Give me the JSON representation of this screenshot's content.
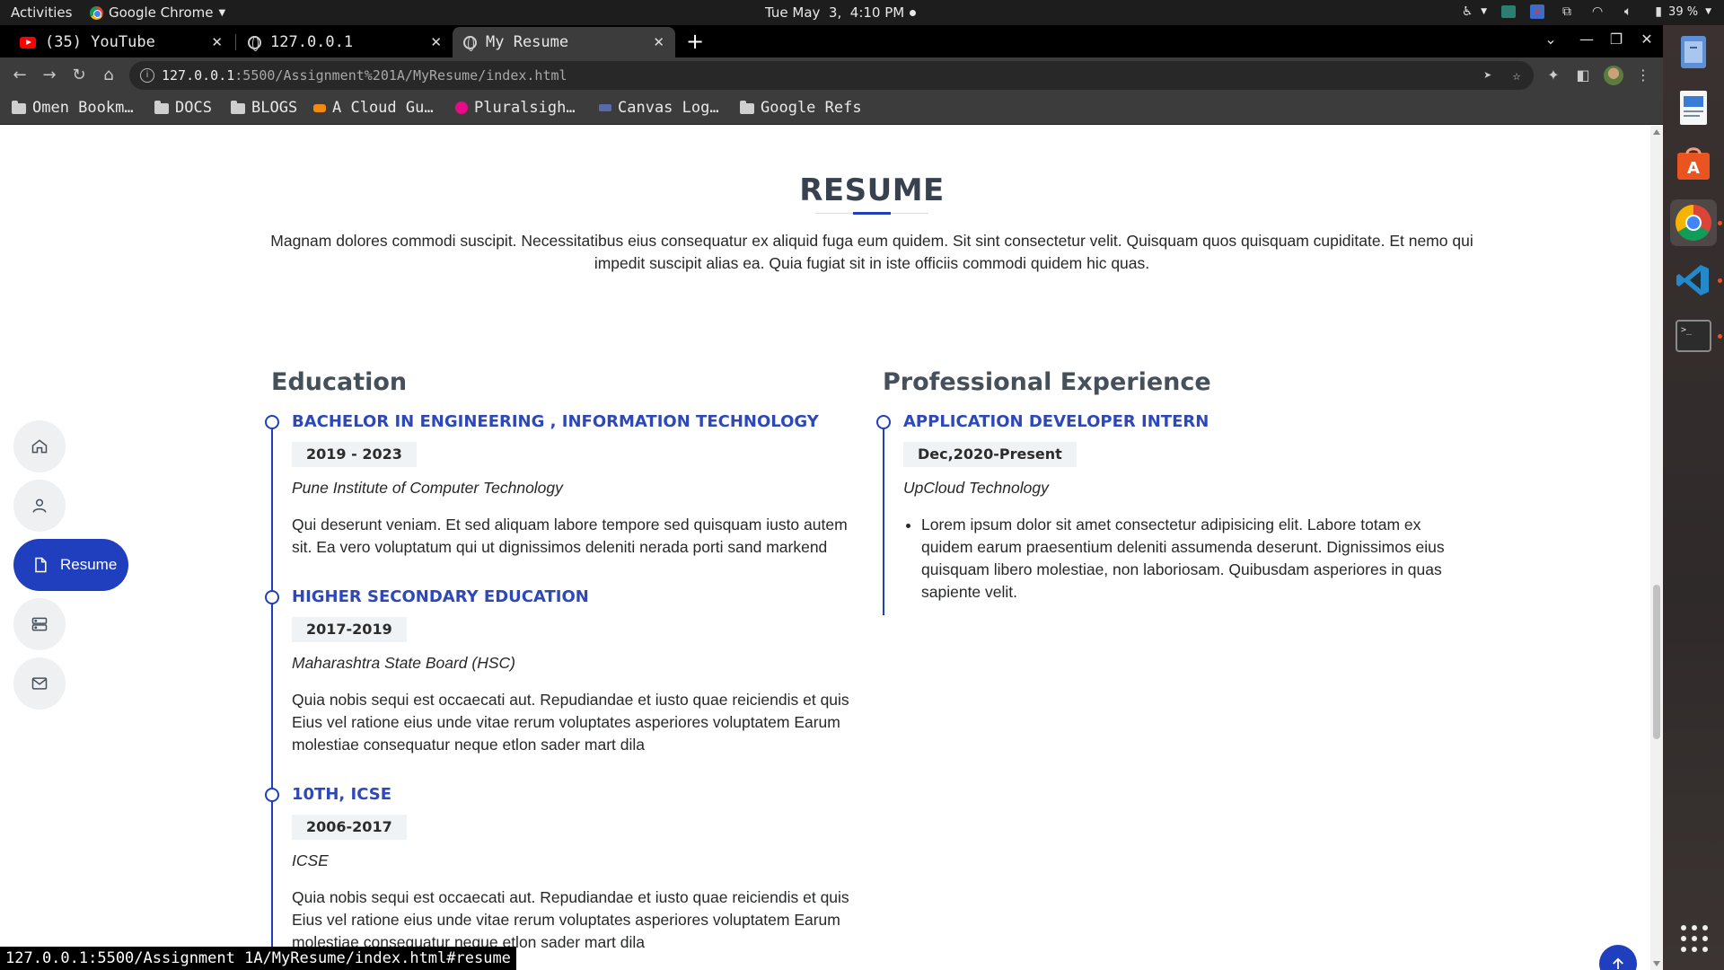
{
  "system": {
    "activities": "Activities",
    "app_name": "Google Chrome",
    "clock": "Tue May  3,  4:10 PM",
    "battery": "39 %"
  },
  "browser": {
    "tabs": [
      {
        "title": "(35) YouTube",
        "icon": "youtube-icon"
      },
      {
        "title": "127.0.0.1",
        "icon": "globe-icon"
      },
      {
        "title": "My Resume",
        "icon": "globe-icon",
        "active": true
      }
    ],
    "url_host": "127.0.0.1",
    "url_path": ":5500/Assignment%201A/MyResume/index.html",
    "bookmarks": [
      {
        "label": "Omen Bookm…",
        "icon": "folder-icon"
      },
      {
        "label": "DOCS",
        "icon": "folder-icon"
      },
      {
        "label": "BLOGS",
        "icon": "folder-icon"
      },
      {
        "label": "A Cloud Gu…",
        "icon": "acloudguru-icon"
      },
      {
        "label": "Pluralsigh…",
        "icon": "pluralsight-icon"
      },
      {
        "label": "Canvas Log…",
        "icon": "canvas-icon"
      },
      {
        "label": "Google Refs",
        "icon": "folder-icon"
      }
    ],
    "status_url": "127.0.0.1:5500/Assignment 1A/MyResume/index.html#resume"
  },
  "sidenav": {
    "items": [
      {
        "name": "home",
        "icon": "home-icon"
      },
      {
        "name": "about",
        "icon": "person-icon"
      },
      {
        "name": "resume",
        "icon": "file-icon",
        "label": "Resume",
        "active": true
      },
      {
        "name": "services",
        "icon": "server-icon"
      },
      {
        "name": "contact",
        "icon": "envelope-icon"
      }
    ]
  },
  "resume": {
    "title": "RESUME",
    "intro": "Magnam dolores commodi suscipit. Necessitatibus eius consequatur ex aliquid fuga eum quidem. Sit sint consectetur velit. Quisquam quos quisquam cupiditate. Et nemo qui impedit suscipit alias ea. Quia fugiat sit in iste officiis commodi quidem hic quas.",
    "education": {
      "heading": "Education",
      "items": [
        {
          "title": "BACHELOR IN ENGINEERING , INFORMATION TECHNOLOGY",
          "date": "2019 - 2023",
          "institution": "Pune Institute of Computer Technology",
          "description": "Qui deserunt veniam. Et sed aliquam labore tempore sed quisquam iusto autem sit. Ea vero voluptatum qui ut dignissimos deleniti nerada porti sand markend"
        },
        {
          "title": "HIGHER SECONDARY EDUCATION",
          "date": "2017-2019",
          "institution": "Maharashtra State Board (HSC)",
          "description": "Quia nobis sequi est occaecati aut. Repudiandae et iusto quae reiciendis et quis Eius vel ratione eius unde vitae rerum voluptates asperiores voluptatem Earum molestiae consequatur neque etlon sader mart dila"
        },
        {
          "title": "10TH, ICSE",
          "date": "2006-2017",
          "institution": "ICSE",
          "description": "Quia nobis sequi est occaecati aut. Repudiandae et iusto quae reiciendis et quis Eius vel ratione eius unde vitae rerum voluptates asperiores voluptatem Earum molestiae consequatur neque etlon sader mart dila"
        }
      ]
    },
    "experience": {
      "heading": "Professional Experience",
      "items": [
        {
          "title": "APPLICATION DEVELOPER INTERN",
          "date": "Dec,2020-Present",
          "company": "UpCloud Technology",
          "bullets": [
            "Lorem ipsum dolor sit amet consectetur adipisicing elit. Labore totam ex quidem earum praesentium deleniti assumenda deserunt. Dignissimos eius quisquam libero molestiae, non laboriosam. Quibusdam asperiores in quas sapiente velit."
          ]
        }
      ]
    }
  },
  "colors": {
    "accent": "#1f3fbf",
    "heading": "#37414f",
    "text": "#272829"
  }
}
